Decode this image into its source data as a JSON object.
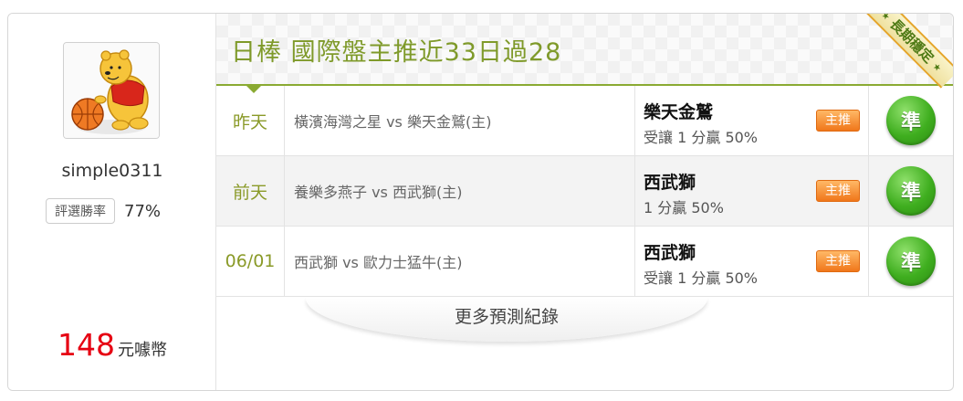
{
  "user": {
    "username": "simple0311",
    "win_rate_label": "評選勝率",
    "win_rate_value": "77%",
    "price_value": "148",
    "price_unit": "元噱幣"
  },
  "header": {
    "title": "日棒 國際盤主推近33日過28",
    "ribbon_label": "長期穩定"
  },
  "rows": [
    {
      "day": "昨天",
      "match": "橫濱海灣之星 vs 樂天金鷲(主)",
      "pick_team": "樂天金鷲",
      "pick_line": "受讓 1 分贏 50%",
      "badge": "主推",
      "result": "準"
    },
    {
      "day": "前天",
      "match": "養樂多燕子 vs 西武獅(主)",
      "pick_team": "西武獅",
      "pick_line": "1 分贏 50%",
      "badge": "主推",
      "result": "準"
    },
    {
      "day": "06/01",
      "match": "西武獅 vs 歐力士猛牛(主)",
      "pick_team": "西武獅",
      "pick_line": "受讓 1 分贏 50%",
      "badge": "主推",
      "result": "準"
    }
  ],
  "more_label": "更多預測紀錄",
  "colors": {
    "accent_green": "#7f9a2a",
    "price_red": "#e60012",
    "badge_orange": "#f0761a",
    "result_green": "#3fae1f"
  }
}
